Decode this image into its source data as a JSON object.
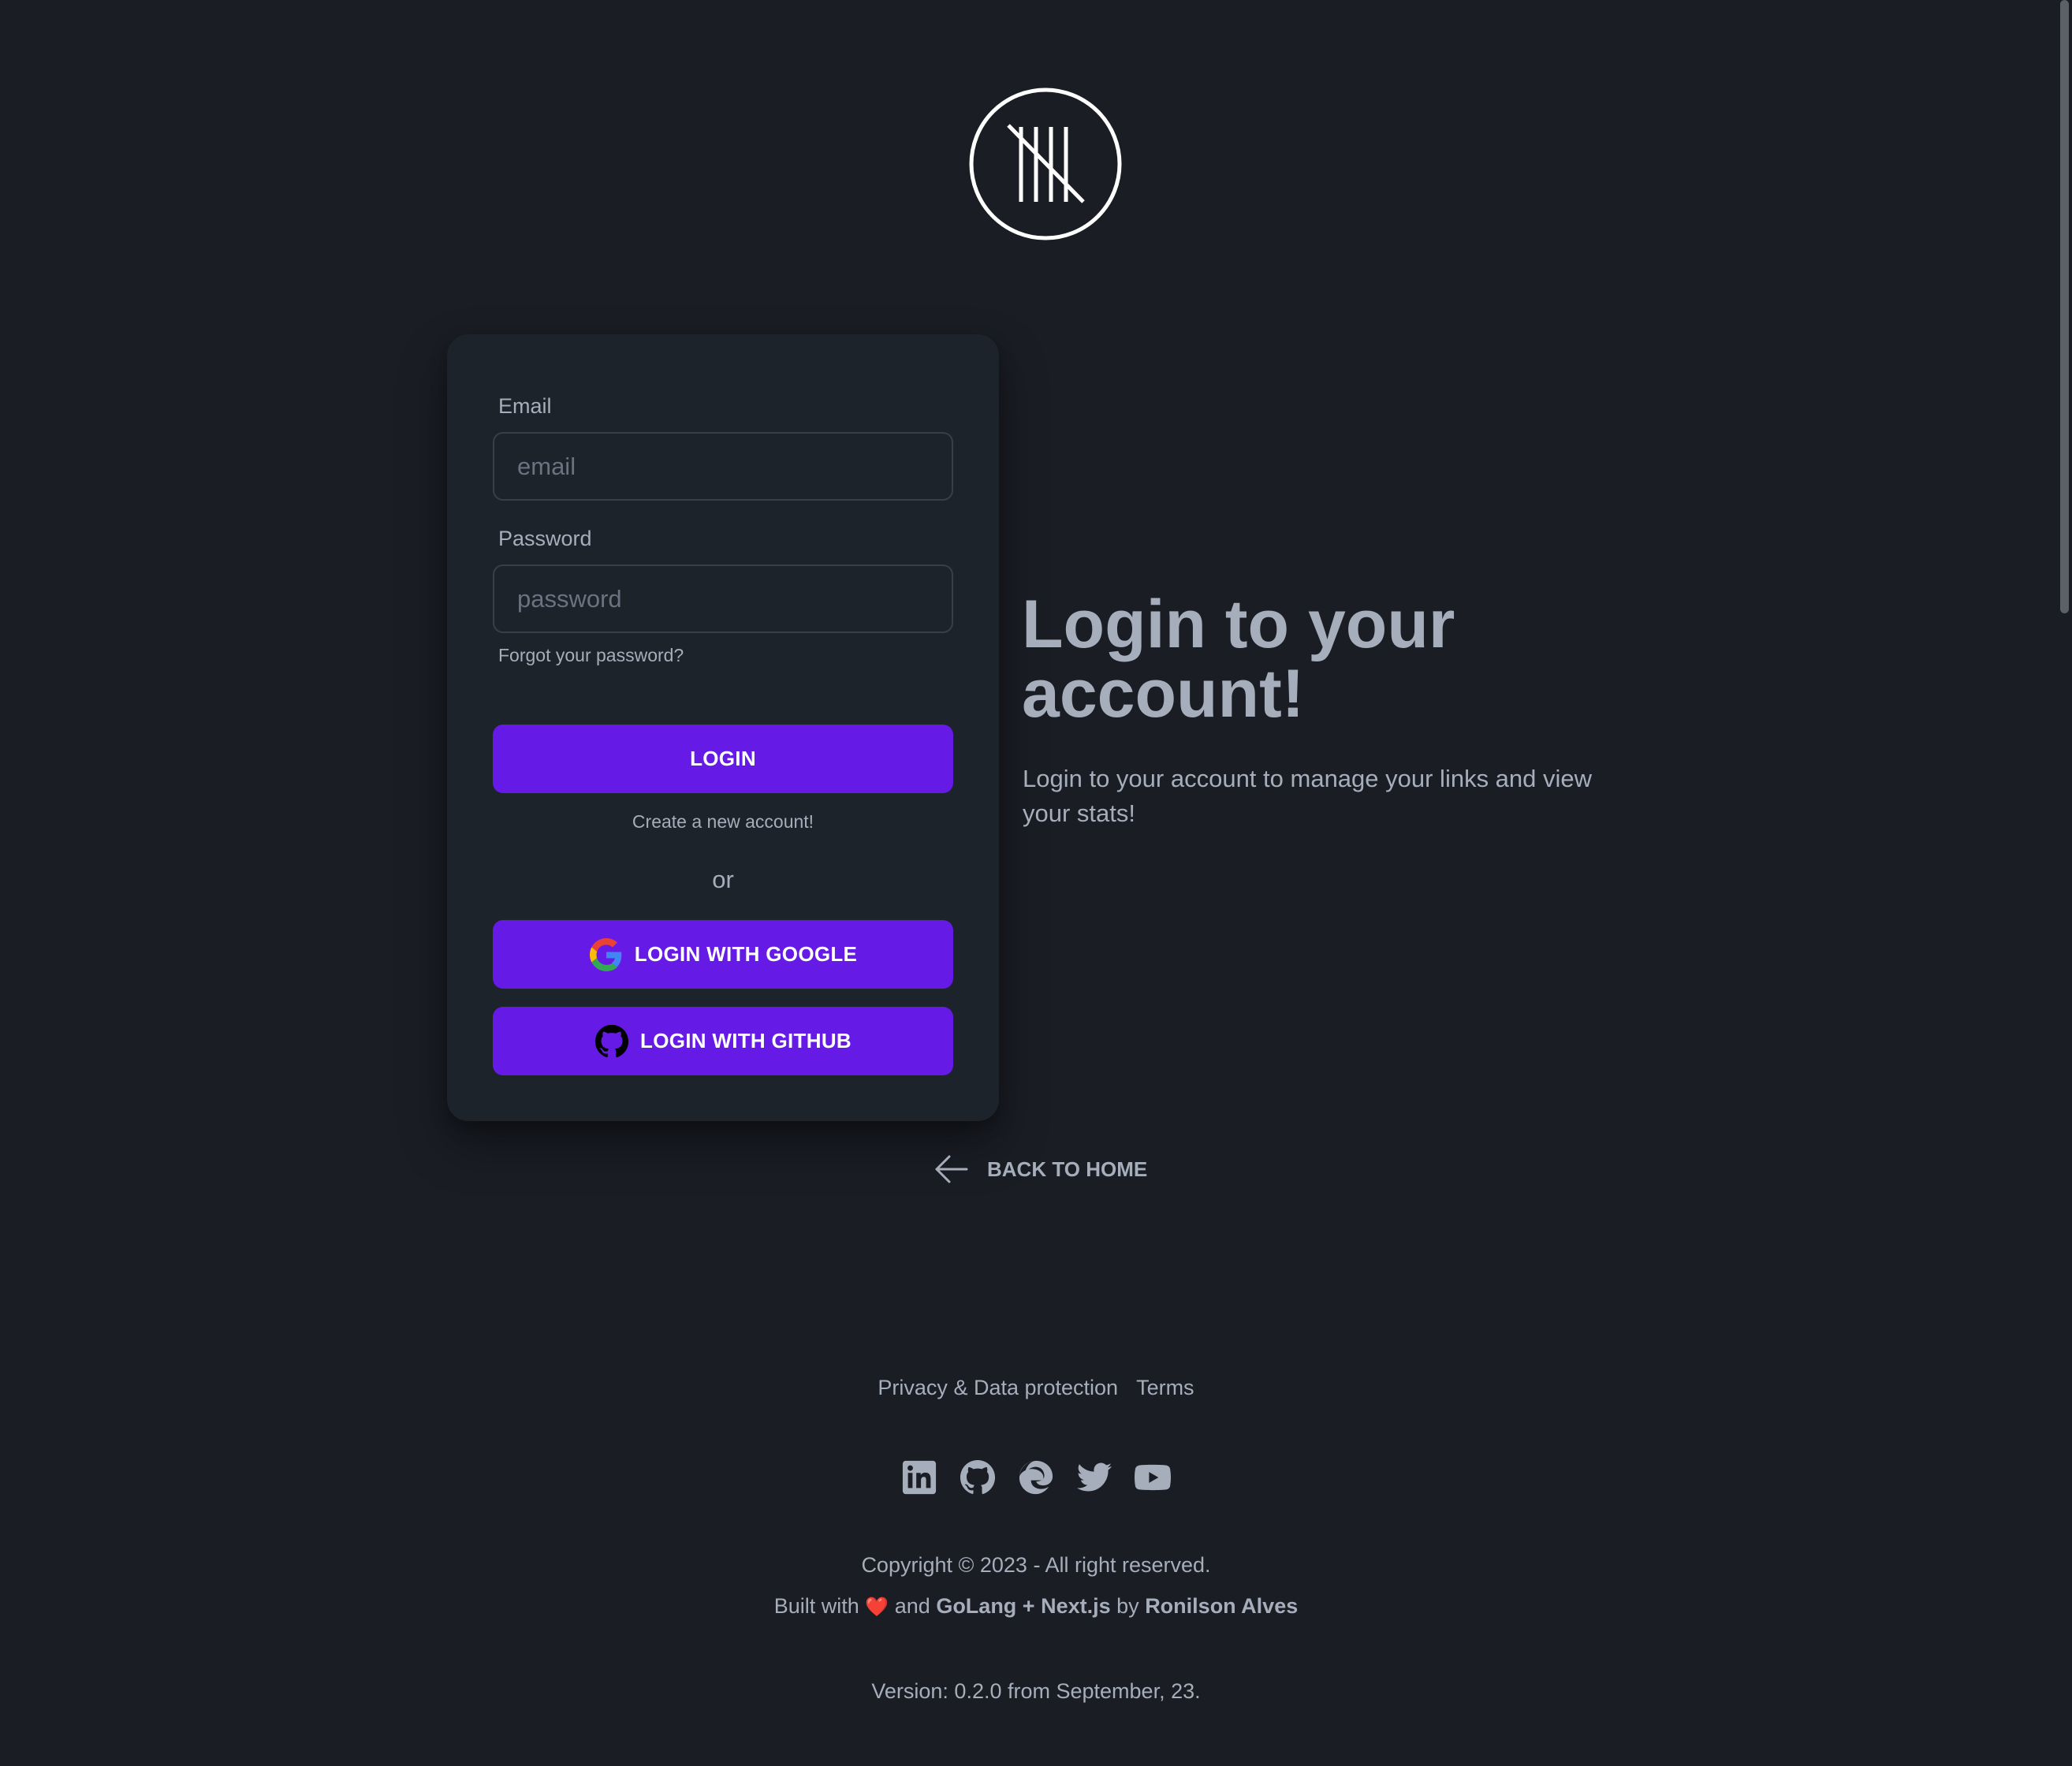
{
  "logo": {
    "icon": "tally-marks-logo"
  },
  "form": {
    "email_label": "Email",
    "email_placeholder": "email",
    "email_value": "",
    "password_label": "Password",
    "password_placeholder": "password",
    "password_value": "",
    "forgot_label": "Forgot your password?",
    "login_label": "LOGIN",
    "create_account_label": "Create a new account!",
    "or_label": "or",
    "google_label": "LOGIN WITH GOOGLE",
    "github_label": "LOGIN WITH GITHUB"
  },
  "hero": {
    "title": "Login to your account!",
    "subtitle": "Login to your account to manage your links and view your stats!"
  },
  "back_home": {
    "label": "BACK TO HOME",
    "icon": "arrow-left-icon"
  },
  "footer": {
    "links": [
      "Privacy & Data protection",
      "Terms"
    ],
    "socials": [
      "linkedin-icon",
      "github-icon",
      "edge-icon",
      "twitter-icon",
      "youtube-icon"
    ],
    "copyright": "Copyright © 2023 - All right reserved.",
    "built_prefix": "Built with",
    "built_heart": "❤️",
    "built_and": "and",
    "built_tech": "GoLang + Next.js",
    "built_by": "by",
    "built_author": "Ronilson Alves",
    "version": "Version: 0.2.0 from September, 23."
  },
  "colors": {
    "background": "#1a1d24",
    "card": "#1d232a",
    "primary": "#661ae6",
    "text": "#a6adbb"
  }
}
